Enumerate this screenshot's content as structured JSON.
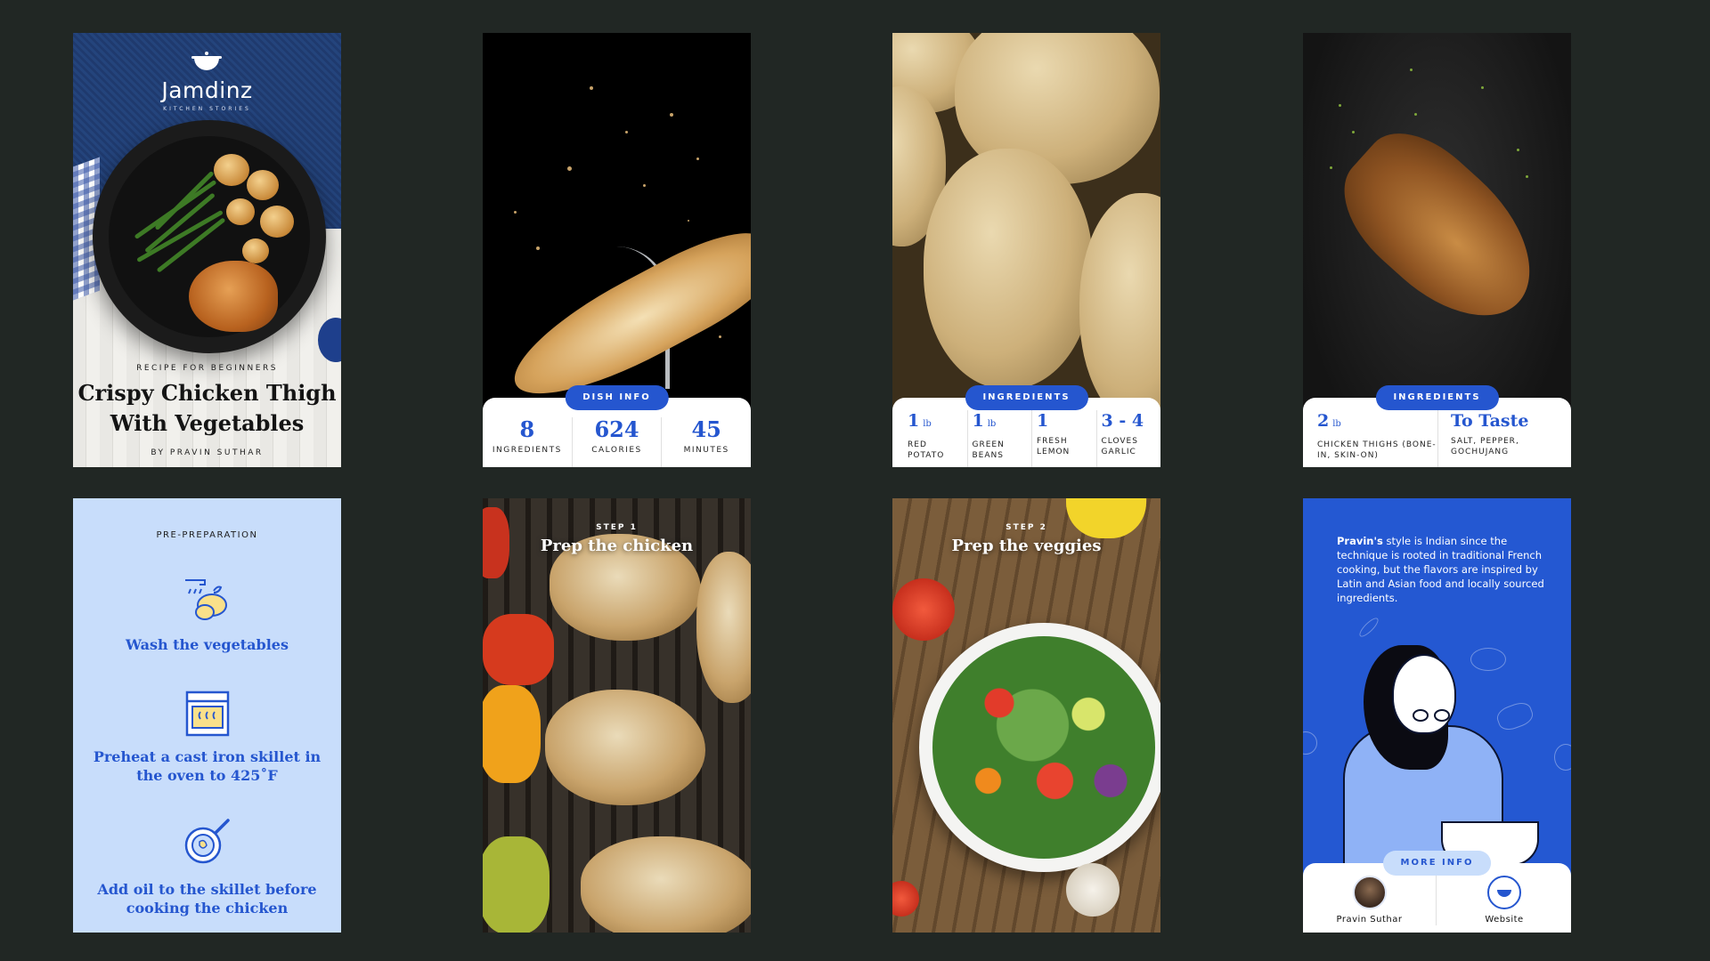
{
  "cards": {
    "cover": {
      "brand": "Jamdinz",
      "brand_tagline": "KITCHEN STORIES",
      "subtitle": "RECIPE FOR BEGINNERS",
      "title_line1": "Crispy Chicken Thigh",
      "title_line2": "With Vegetables",
      "author": "BY PRAVIN SUTHAR"
    },
    "dish_info": {
      "badge": "DISH INFO",
      "stats": [
        {
          "value": "8",
          "label": "INGREDIENTS"
        },
        {
          "value": "624",
          "label": "CALORIES"
        },
        {
          "value": "45",
          "label": "MINUTES"
        }
      ]
    },
    "ingredients_1": {
      "badge": "INGREDIENTS",
      "items": [
        {
          "qty": "1",
          "unit": "lb",
          "name": "RED POTATO"
        },
        {
          "qty": "1",
          "unit": "lb",
          "name": "GREEN BEANS"
        },
        {
          "qty": "1",
          "unit": "",
          "name": "FRESH LEMON"
        },
        {
          "qty": "3 - 4",
          "unit": "",
          "name": "CLOVES GARLIC"
        }
      ]
    },
    "ingredients_2": {
      "badge": "INGREDIENTS",
      "items": [
        {
          "qty": "2",
          "unit": "lb",
          "name": "CHICKEN THIGHS (BONE-IN, SKIN-ON)"
        },
        {
          "qty": "To Taste",
          "unit": "",
          "name": "SALT, PEPPER, GOCHUJANG"
        }
      ]
    },
    "pre_prep": {
      "heading": "PRE-PREPARATION",
      "steps": [
        {
          "icon": "wash-vegetables-icon",
          "text": "Wash the vegetables"
        },
        {
          "icon": "oven-icon",
          "text": "Preheat a cast iron skillet in the oven to 425˚F"
        },
        {
          "icon": "skillet-icon",
          "text": "Add oil to the skillet before cooking the chicken"
        }
      ]
    },
    "step1": {
      "step": "STEP 1",
      "title": "Prep the chicken"
    },
    "step2": {
      "step": "STEP 2",
      "title": "Prep the veggies"
    },
    "about": {
      "bio_name": "Pravin's",
      "bio_rest": " style is Indian since the technique is rooted in traditional French cooking, but the flavors are inspired by Latin and Asian food and locally sourced ingredients.",
      "badge": "MORE INFO",
      "author_label": "Pravin Suthar",
      "website_label": "Website"
    }
  },
  "colors": {
    "background": "#212724",
    "accent": "#2556cf",
    "light_blue": "#c8ddfb"
  }
}
